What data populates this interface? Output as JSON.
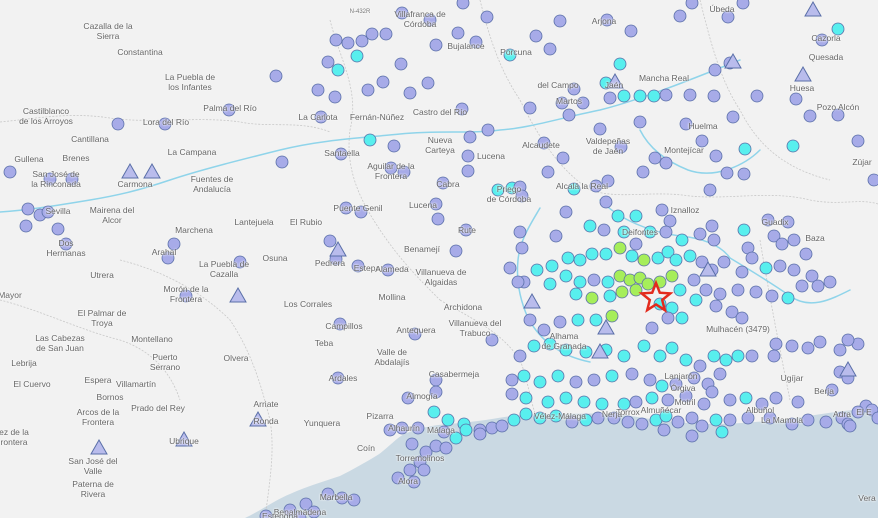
{
  "map": {
    "colors": {
      "land": "#f2f2f2",
      "sea": "#cad9e3",
      "river": "#8fd4ea",
      "border": "#c4c4c4",
      "station_blue": "#a7abe8",
      "station_cyan": "#58efee",
      "station_green": "#a6ee5a",
      "station_stroke": "#5a6fa8",
      "triangle_fill": "#b9bcec",
      "epicenter": "#e32b1d"
    },
    "labels": [
      {
        "id": "cazalla",
        "text": "Cazalla de la\nSierra"
      },
      {
        "id": "constantina",
        "text": "Constantina"
      },
      {
        "id": "villafranca",
        "text": "Villafranca de\nCórdoba"
      },
      {
        "id": "bujalance",
        "text": "Bujalance"
      },
      {
        "id": "porcuna",
        "text": "Porcuna"
      },
      {
        "id": "arjona",
        "text": "Arjona"
      },
      {
        "id": "ubeda",
        "text": "Úbeda"
      },
      {
        "id": "cazorla",
        "text": "Cazorla"
      },
      {
        "id": "quesada",
        "text": "Quesada"
      },
      {
        "id": "huesa",
        "text": "Huesa"
      },
      {
        "id": "pozoalcon",
        "text": "Pozo Alcón"
      },
      {
        "id": "puebla_infantes",
        "text": "La Puebla de\nlos Infantes"
      },
      {
        "id": "palma",
        "text": "Palma del Río"
      },
      {
        "id": "castilblanco",
        "text": "Castilblanco\nde los Arroyos"
      },
      {
        "id": "lora",
        "text": "Lora del Río"
      },
      {
        "id": "lacarlota",
        "text": "La Carlota"
      },
      {
        "id": "fernan",
        "text": "Fernán-Núñez"
      },
      {
        "id": "castro",
        "text": "Castro del Río"
      },
      {
        "id": "jaen",
        "text": "Jaén"
      },
      {
        "id": "mancha",
        "text": "Mancha Real"
      },
      {
        "id": "martos",
        "text": "Martos"
      },
      {
        "id": "torredelcampo",
        "text": "del Campo"
      },
      {
        "id": "cantillana",
        "text": "Cantillana"
      },
      {
        "id": "lacampana",
        "text": "La Campana"
      },
      {
        "id": "gullena",
        "text": "Gullena"
      },
      {
        "id": "brenes",
        "text": "Brenes"
      },
      {
        "id": "sanjose",
        "text": "San José de\nla Rinconada"
      },
      {
        "id": "carmona",
        "text": "Carmona"
      },
      {
        "id": "fuentes",
        "text": "Fuentes de\nAndalucía"
      },
      {
        "id": "santaella",
        "text": "Santaella"
      },
      {
        "id": "aguilar",
        "text": "Aguilar de la\nFrontera"
      },
      {
        "id": "nuevacarteya",
        "text": "Nueva\nCarteya"
      },
      {
        "id": "lucena_top",
        "text": "Lucena"
      },
      {
        "id": "alcaudete",
        "text": "Alcaudete"
      },
      {
        "id": "valdepenas",
        "text": "Valdepeñas\nde Jaén"
      },
      {
        "id": "huelma",
        "text": "Huelma"
      },
      {
        "id": "montejicar",
        "text": "Montejícar"
      },
      {
        "id": "zujar",
        "text": "Zújar"
      },
      {
        "id": "mairena",
        "text": "Mairena del\nAlcor"
      },
      {
        "id": "sevilla",
        "text": "Sevilla"
      },
      {
        "id": "dos_hermanas",
        "text": "Dos\nHermanas"
      },
      {
        "id": "marchena",
        "text": "Marchena"
      },
      {
        "id": "lantejuela",
        "text": "Lantejuela"
      },
      {
        "id": "elrubio",
        "text": "El Rubio"
      },
      {
        "id": "puentegenil",
        "text": "Puente Genil"
      },
      {
        "id": "lucena",
        "text": "Lucena"
      },
      {
        "id": "cabra",
        "text": "Cabra"
      },
      {
        "id": "priego",
        "text": "Priego\nde Córdoba"
      },
      {
        "id": "alcala",
        "text": "Alcalá la Real"
      },
      {
        "id": "iznalloz",
        "text": "Iznalloz"
      },
      {
        "id": "rute",
        "text": "Rute"
      },
      {
        "id": "guadix",
        "text": "Guadix"
      },
      {
        "id": "baza",
        "text": "Baza"
      },
      {
        "id": "benamejí",
        "text": "Benamejí"
      },
      {
        "id": "deifontes",
        "text": "Deifontes"
      },
      {
        "id": "utrera",
        "text": "Utrera"
      },
      {
        "id": "arahal",
        "text": "Arahal"
      },
      {
        "id": "puebla_cazalla",
        "text": "La Puebla de\nCazalla"
      },
      {
        "id": "osuna",
        "text": "Osuna"
      },
      {
        "id": "pedrera",
        "text": "Pedrera"
      },
      {
        "id": "estepa",
        "text": "Estepa"
      },
      {
        "id": "alameda",
        "text": "Alameda"
      },
      {
        "id": "villanueva_algaidas",
        "text": "Villanueva de\nAlgaidas"
      },
      {
        "id": "mayor",
        "text": "Mayor"
      },
      {
        "id": "palmar",
        "text": "El Palmar de\nTroya"
      },
      {
        "id": "moron",
        "text": "Morón de la\nFrontera"
      },
      {
        "id": "loscorrales",
        "text": "Los Corrales"
      },
      {
        "id": "molina",
        "text": "Mollina"
      },
      {
        "id": "archidona",
        "text": "Archidona"
      },
      {
        "id": "villanueva_trabuco",
        "text": "Villanueva del\nTrabuco"
      },
      {
        "id": "alhama",
        "text": "Alhama\nde Granada"
      },
      {
        "id": "lascabezas",
        "text": "Las Cabezas\nde San Juan"
      },
      {
        "id": "montellano",
        "text": "Montellano"
      },
      {
        "id": "campillos",
        "text": "Campillos"
      },
      {
        "id": "antequera",
        "text": "Antequera"
      },
      {
        "id": "mulhacen",
        "text": "Mulhacén (3479)"
      },
      {
        "id": "lebrija",
        "text": "Lebrija"
      },
      {
        "id": "puerto_serrano",
        "text": "Puerto\nSerrano"
      },
      {
        "id": "teba",
        "text": "Teba"
      },
      {
        "id": "valle_abdalajis",
        "text": "Valle de\nAbdalajís"
      },
      {
        "id": "olvera",
        "text": "Olvera"
      },
      {
        "id": "elcuervo",
        "text": "El Cuervo"
      },
      {
        "id": "espera",
        "text": "Espera"
      },
      {
        "id": "villamartin",
        "text": "Villamartín"
      },
      {
        "id": "ardales",
        "text": "Ardales"
      },
      {
        "id": "casabermeja",
        "text": "Casabermeja"
      },
      {
        "id": "bornos",
        "text": "Bornos"
      },
      {
        "id": "almogia",
        "text": "Almogía"
      },
      {
        "id": "prado",
        "text": "Prado del Rey"
      },
      {
        "id": "arcos",
        "text": "Arcos de la\nFrontera"
      },
      {
        "id": "arriate",
        "text": "Arriate"
      },
      {
        "id": "ronda",
        "text": "Ronda"
      },
      {
        "id": "pizarra",
        "text": "Pizarra"
      },
      {
        "id": "yunquera",
        "text": "Yunquera"
      },
      {
        "id": "jerez",
        "text": "ez de la\nrontera"
      },
      {
        "id": "coin",
        "text": "Coín"
      },
      {
        "id": "malaga",
        "text": "Málaga"
      },
      {
        "id": "ubrique",
        "text": "Ubrique"
      },
      {
        "id": "sanjose_valle",
        "text": "San José del\nValle"
      },
      {
        "id": "torremolinos",
        "text": "Torremolinos"
      },
      {
        "id": "paterna",
        "text": "Paterna de\nRivera"
      },
      {
        "id": "alora_sur",
        "text": "Alora"
      },
      {
        "id": "marbella",
        "text": "Marbella"
      },
      {
        "id": "benalmadena",
        "text": "Benalmádena"
      },
      {
        "id": "albunol",
        "text": "Albuñol"
      },
      {
        "id": "adra",
        "text": "Adra"
      },
      {
        "id": "elejido",
        "text": "El E"
      },
      {
        "id": "motril",
        "text": "Motril"
      },
      {
        "id": "torrox",
        "text": "Torrox"
      },
      {
        "id": "lamamola",
        "text": "La Mamola"
      },
      {
        "id": "berja",
        "text": "Berja"
      },
      {
        "id": "ugijar",
        "text": "Ugíjar"
      },
      {
        "id": "orgiva",
        "text": "Órgiva"
      },
      {
        "id": "estepona",
        "text": "Estepona"
      },
      {
        "id": "alhaurin",
        "text": "Alhaurín"
      },
      {
        "id": "vera",
        "text": "Vera"
      },
      {
        "id": "almunecar",
        "text": "Almuñécar"
      },
      {
        "id": "lanjaron",
        "text": "Lanjarón"
      },
      {
        "id": "velez",
        "text": "Vélez-Málaga"
      },
      {
        "id": "nerja",
        "text": "Nerja"
      }
    ],
    "road_labels": [
      {
        "id": "n432",
        "text": "N-432R"
      }
    ],
    "epicenter": {
      "label": "Epicenter"
    }
  }
}
